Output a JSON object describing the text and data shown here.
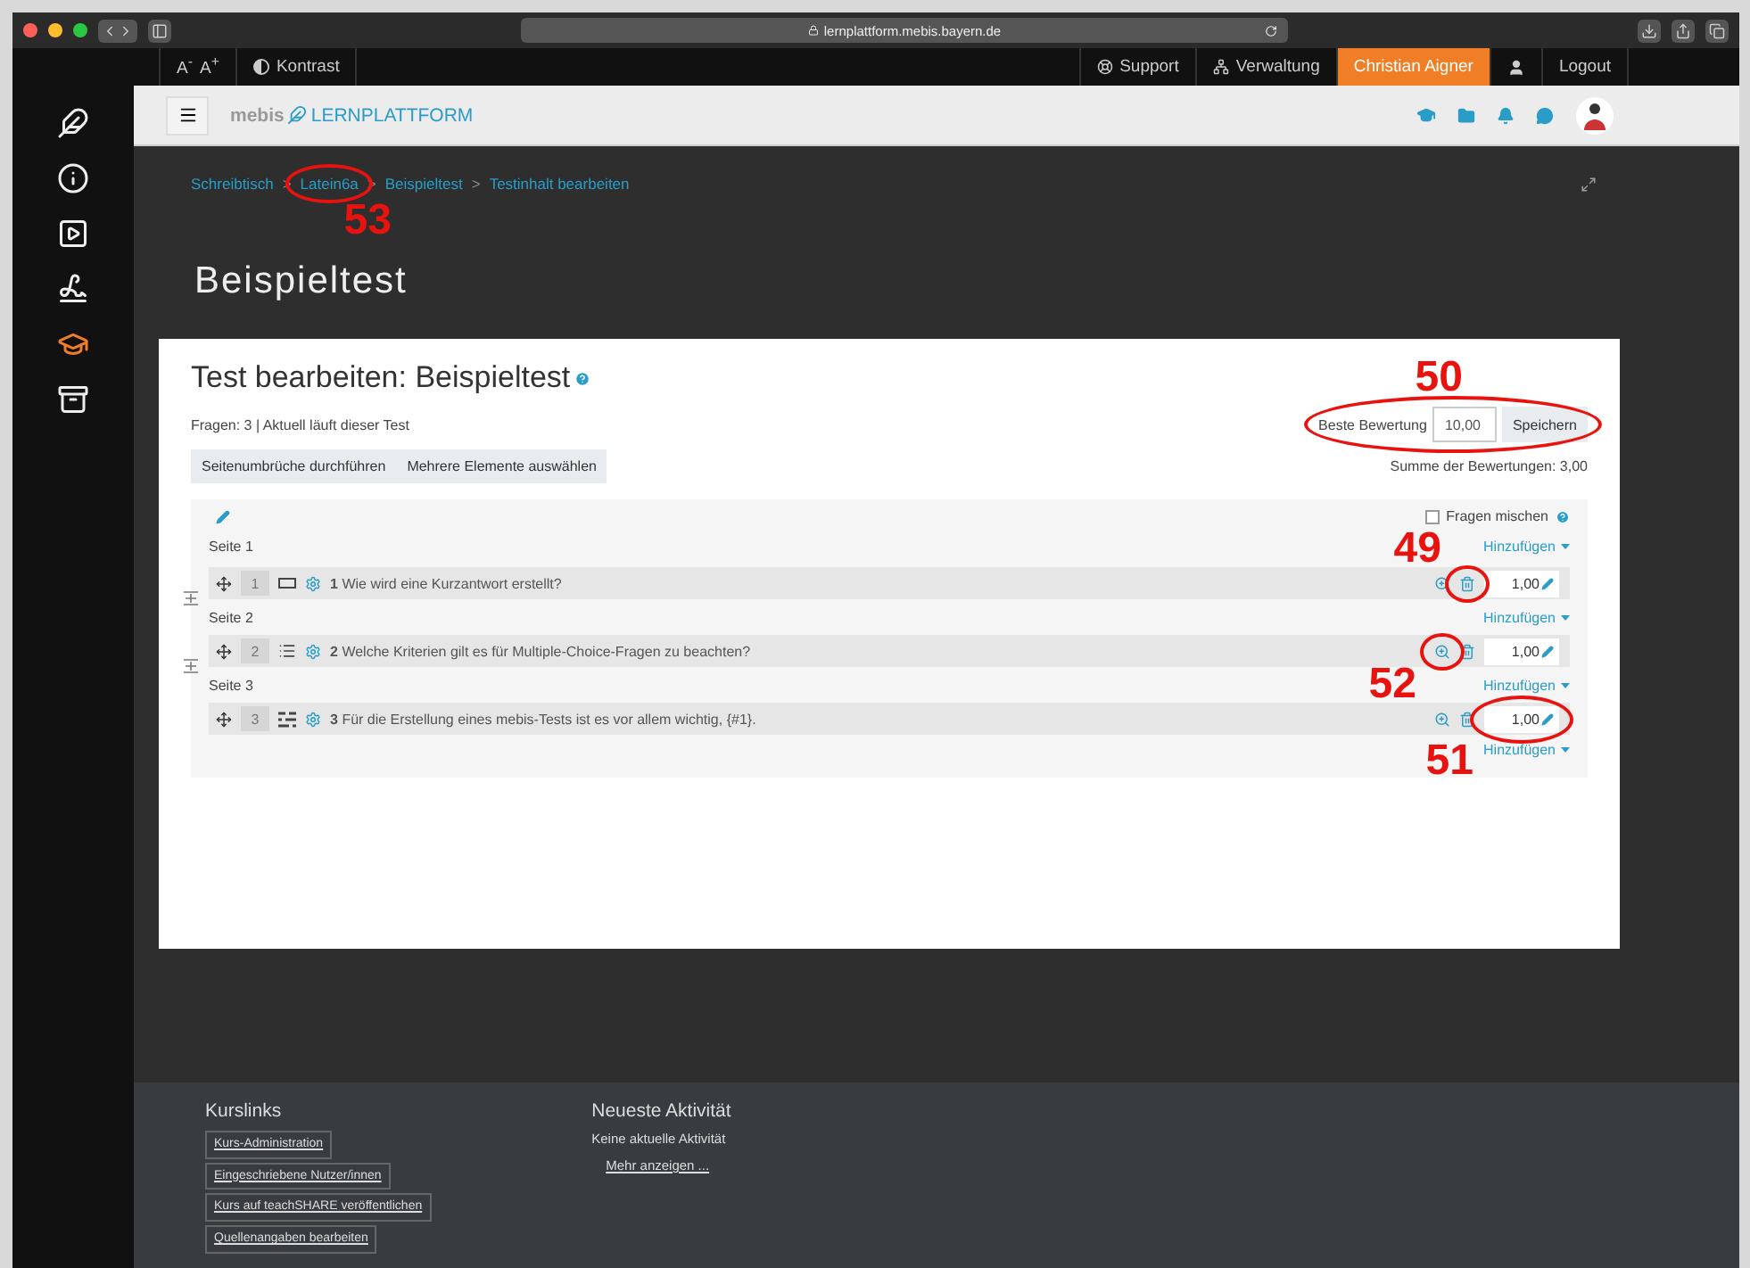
{
  "browser": {
    "url": "lernplattform.mebis.bayern.de"
  },
  "topbar": {
    "font_sizes": [
      "A$^{-}$",
      "A$^{+}$"
    ],
    "contrast": "Kontrast",
    "links": [
      {
        "kind": "support",
        "label": "Support",
        "selected": false
      },
      {
        "kind": "admin",
        "label": "Verwaltung",
        "selected": false
      },
      {
        "kind": "user",
        "label": "Christian Aigner",
        "selected": true
      }
    ],
    "logout": "Logout"
  },
  "header": {
    "logo_prefix": "mebis",
    "logo_suffix": "LERNPLATTFORM"
  },
  "sidebar": [
    {
      "kind": "logo",
      "selected": false
    },
    {
      "kind": "info",
      "selected": false
    },
    {
      "kind": "media",
      "selected": false
    },
    {
      "kind": "sign",
      "selected": false
    },
    {
      "kind": "courses",
      "selected": true
    },
    {
      "kind": "archive",
      "selected": false
    }
  ],
  "breadcrumbs": [
    {
      "label": "Schreibtisch"
    },
    {
      "separator": ">",
      "label": "Latein6a",
      "annotation": {
        "number": "53"
      }
    },
    {
      "separator": ">",
      "label": "Beispieltest"
    },
    {
      "separator": ">",
      "label": "Testinhalt bearbeiten"
    }
  ],
  "page_title": "Beispieltest",
  "card": {
    "heading": "Test bearbeiten: Beispieltest",
    "info": "Fragen: 3 | Aktuell läuft dieser Test",
    "buttons": [
      "Seitenumbrüche durchführen",
      "Mehrere Elemente auswählen"
    ],
    "max_grade": {
      "label": "Beste Bewertung",
      "value": "10,00",
      "button": "Speichern",
      "annotation": {
        "number": "50"
      }
    },
    "total": "Summe der Bewertungen: 3,00",
    "shuffle": {
      "label": "Fragen mischen",
      "checked": false
    },
    "pages": [
      {
        "label": "Seite 1",
        "add": "Hinzufügen",
        "questions": [
          {
            "slot": "1",
            "kind": "shortanswer",
            "number": "1",
            "text": "Wie wird eine Kurzantwort erstellt?",
            "mark": "1,00",
            "annotations": {
              "delete": {
                "number": "49"
              }
            }
          }
        ]
      },
      {
        "label": "Seite 2",
        "add": "Hinzufügen",
        "questions": [
          {
            "slot": "2",
            "kind": "multichoice",
            "number": "2",
            "text": "Welche Kriterien gilt es für Multiple-Choice-Fragen zu beachten?",
            "mark": "1,00",
            "annotations": {
              "preview": {
                "number": "52"
              }
            }
          }
        ]
      },
      {
        "label": "Seite 3",
        "add": "Hinzufügen",
        "questions": [
          {
            "slot": "3",
            "kind": "gapselect",
            "number": "3",
            "text": "Für die Erstellung eines mebis-Tests ist es vor allem wichtig, {#1}.",
            "mark": "1,00",
            "annotations": {
              "mark": {
                "number": "51"
              }
            }
          }
        ]
      }
    ],
    "final_add": "Hinzufügen"
  },
  "footer": {
    "links_title": "Kurslinks",
    "links": [
      "Kurs-Administration",
      "Eingeschriebene Nutzer/innen",
      "Kurs auf teachSHARE veröffentlichen",
      "Quellenangaben bearbeiten"
    ],
    "activity_title": "Neueste Aktivität",
    "activity_text": "Keine aktuelle Aktivität",
    "more": "Mehr anzeigen ..."
  }
}
